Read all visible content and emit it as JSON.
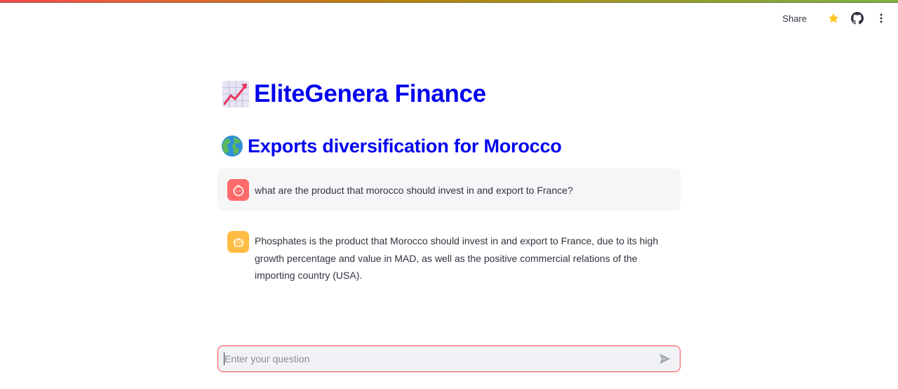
{
  "header": {
    "share_label": "Share",
    "icons": [
      "star-icon",
      "github-icon",
      "more-vertical-icon"
    ],
    "accent_colors": [
      "#ff4b4b",
      "#b8860b",
      "#7cb342"
    ]
  },
  "page": {
    "title_icon": "chart-increasing-emoji",
    "title": "EliteGenera Finance",
    "subtitle_icon": "globe-emoji",
    "subtitle": "Exports diversification for Morocco",
    "heading_color": "#0000ee"
  },
  "chat": {
    "messages": [
      {
        "role": "user",
        "avatar_icon": "user-face-icon",
        "avatar_color": "#ff6b6b",
        "text": "what are the product that morocco should invest in and export to France?"
      },
      {
        "role": "assistant",
        "avatar_icon": "robot-icon",
        "avatar_color": "#ffbd45",
        "text": "Phosphates is the product that Morocco should invest in and export to France, due to its high growth percentage and value in MAD, as well as the positive commercial relations of the importing country (USA)."
      }
    ],
    "input": {
      "placeholder": "Enter your question",
      "value": "",
      "send_icon": "send-icon"
    }
  }
}
